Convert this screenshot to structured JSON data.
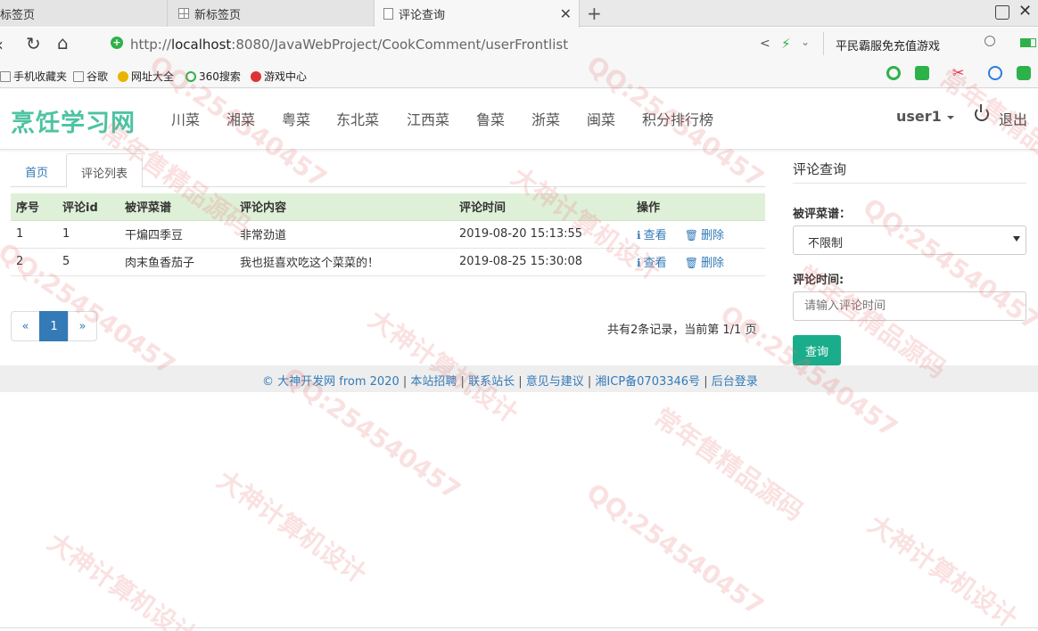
{
  "browser": {
    "tabs": [
      {
        "label": "标签页"
      },
      {
        "label": "新标签页"
      },
      {
        "label": "评论查询"
      }
    ],
    "new_tab": "+",
    "url_prefix": "http://",
    "url_host": "localhost",
    "url_rest": ":8080/JavaWebProject/CookComment/userFrontlist",
    "search_ad": "平民霸服免充值游戏",
    "bookmarks": [
      "手机收藏夹",
      "谷歌",
      "网址大全",
      "360搜索",
      "游戏中心"
    ]
  },
  "header": {
    "logo": "烹饪学习网",
    "nav": [
      "川菜",
      "湘菜",
      "粤菜",
      "东北菜",
      "江西菜",
      "鲁菜",
      "浙菜",
      "闽菜",
      "积分排行榜"
    ],
    "user": "user1",
    "logout": "退出"
  },
  "content": {
    "tabs": {
      "home": "首页",
      "list": "评论列表"
    },
    "table": {
      "headers": [
        "序号",
        "评论id",
        "被评菜谱",
        "评论内容",
        "评论时间",
        "操作"
      ],
      "rows": [
        {
          "no": "1",
          "id": "1",
          "recipe": "干煸四季豆",
          "content": "非常劲道",
          "time": "2019-08-20 15:13:55",
          "view": "查看",
          "delete": "删除"
        },
        {
          "no": "2",
          "id": "5",
          "recipe": "肉末鱼香茄子",
          "content": "我也挺喜欢吃这个菜菜的！",
          "time": "2019-08-25 15:30:08",
          "view": "查看",
          "delete": "删除"
        }
      ]
    },
    "pager": {
      "prev": "«",
      "current": "1",
      "next": "»"
    },
    "record_info": "共有2条记录，当前第 1/1 页"
  },
  "sidebar": {
    "title": "评论查询",
    "recipe_label": "被评菜谱：",
    "recipe_value": "不限制",
    "time_label": "评论时间:",
    "time_placeholder": "请输入评论时间",
    "query_button": "查询"
  },
  "footer": {
    "copyright": "© 大神开发网 from 2020",
    "links": [
      "本站招聘",
      "联系站长",
      "意见与建议",
      "湘ICP备0703346号",
      "后台登录"
    ]
  },
  "watermark": {
    "qq": "QQ:254540457",
    "brand": "大神计算机设计",
    "slogan": "常年售精品源码"
  },
  "colors": {
    "accent": "#4dc3a2",
    "link": "#337ab7",
    "table_head": "#dff0d8",
    "button": "#1aad8b"
  }
}
